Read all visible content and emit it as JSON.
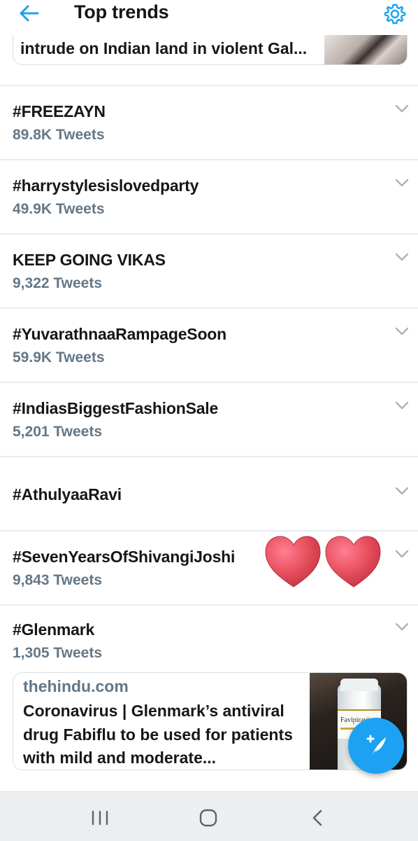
{
  "header": {
    "title": "Top trends",
    "back_icon": "arrow-left-icon",
    "settings_icon": "gear-icon",
    "accent_color": "#1da1f2"
  },
  "top_card": {
    "headline_fragment": "intrude on Indian land in violent Gal..."
  },
  "trends": [
    {
      "name": "#FREEZAYN",
      "count": "89.8K Tweets"
    },
    {
      "name": "#harrystylesislovedparty",
      "count": "49.9K Tweets"
    },
    {
      "name": "KEEP GOING VIKAS",
      "count": "9,322 Tweets"
    },
    {
      "name": "#YuvarathnaaRampageSoon",
      "count": "59.9K Tweets"
    },
    {
      "name": "#IndiasBiggestFashionSale",
      "count": "5,201 Tweets"
    },
    {
      "name": "#AthulyaaRavi",
      "count": ""
    },
    {
      "name": "#SevenYearsOfShivangiJoshi",
      "count": "9,843 Tweets"
    },
    {
      "name": "#Glenmark",
      "count": "1,305 Tweets"
    }
  ],
  "news_card": {
    "source": "thehindu.com",
    "headline": "Coronavirus | Glenmark’s antiviral drug Fabiflu to be used for patients with mild and moderate...",
    "image_label": "Favipiravir"
  },
  "fab": {
    "icon": "compose-tweet-icon"
  },
  "nav": {
    "icons": [
      "recent-apps-icon",
      "home-icon",
      "back-icon"
    ]
  }
}
